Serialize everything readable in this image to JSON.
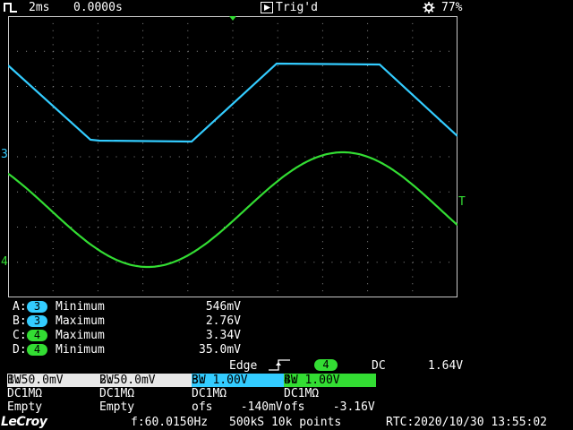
{
  "status": {
    "timebase": "2ms",
    "delay": "0.0000s",
    "trigger_state": "Trig'd",
    "battery": "77%"
  },
  "markers": {
    "ch3_ref": "3",
    "ch4_ref": "4",
    "trigger_level": "T"
  },
  "measurements": [
    {
      "letter": "A:",
      "channel": "3",
      "name": "Minimum",
      "value": "546mV",
      "color": "#33ccff"
    },
    {
      "letter": "B:",
      "channel": "3",
      "name": "Maximum",
      "value": "2.76V",
      "color": "#33ccff"
    },
    {
      "letter": "C:",
      "channel": "4",
      "name": "Maximum",
      "value": "3.34V",
      "color": "#33dd33"
    },
    {
      "letter": "D:",
      "channel": "4",
      "name": "Minimum",
      "value": "35.0mV",
      "color": "#33dd33"
    }
  ],
  "trigger": {
    "type": "Edge",
    "channel": "4",
    "coupling": "DC",
    "level": "1.64V"
  },
  "channels": [
    {
      "head": "1:50.0mV",
      "bw": "BW",
      "line2": "DC1MΩ",
      "line3": "Empty"
    },
    {
      "head": "2:50.0mV",
      "bw": "BW",
      "line2": "DC1MΩ",
      "line3": "Empty"
    },
    {
      "head": "3: 1.00V",
      "bw": "BW",
      "line2": "DC1MΩ",
      "line3": "ofs    -140mV"
    },
    {
      "head": "4: 1.00V",
      "bw": "BW",
      "line2": "DC1MΩ",
      "line3": "ofs    -3.16V"
    }
  ],
  "bottom": {
    "brand": "LeCroy",
    "frequency": "f:60.0150Hz",
    "memory": "500kS 10k points",
    "rtc": "RTC:2020/10/30 13:55:02"
  },
  "colors": {
    "ch1_head": "#e8e8e8",
    "ch2_head": "#e8e8e8",
    "ch3": "#33ccff",
    "ch4": "#33dd33",
    "grid": "#8c8c8c",
    "frame": "#c8c8c8"
  }
}
